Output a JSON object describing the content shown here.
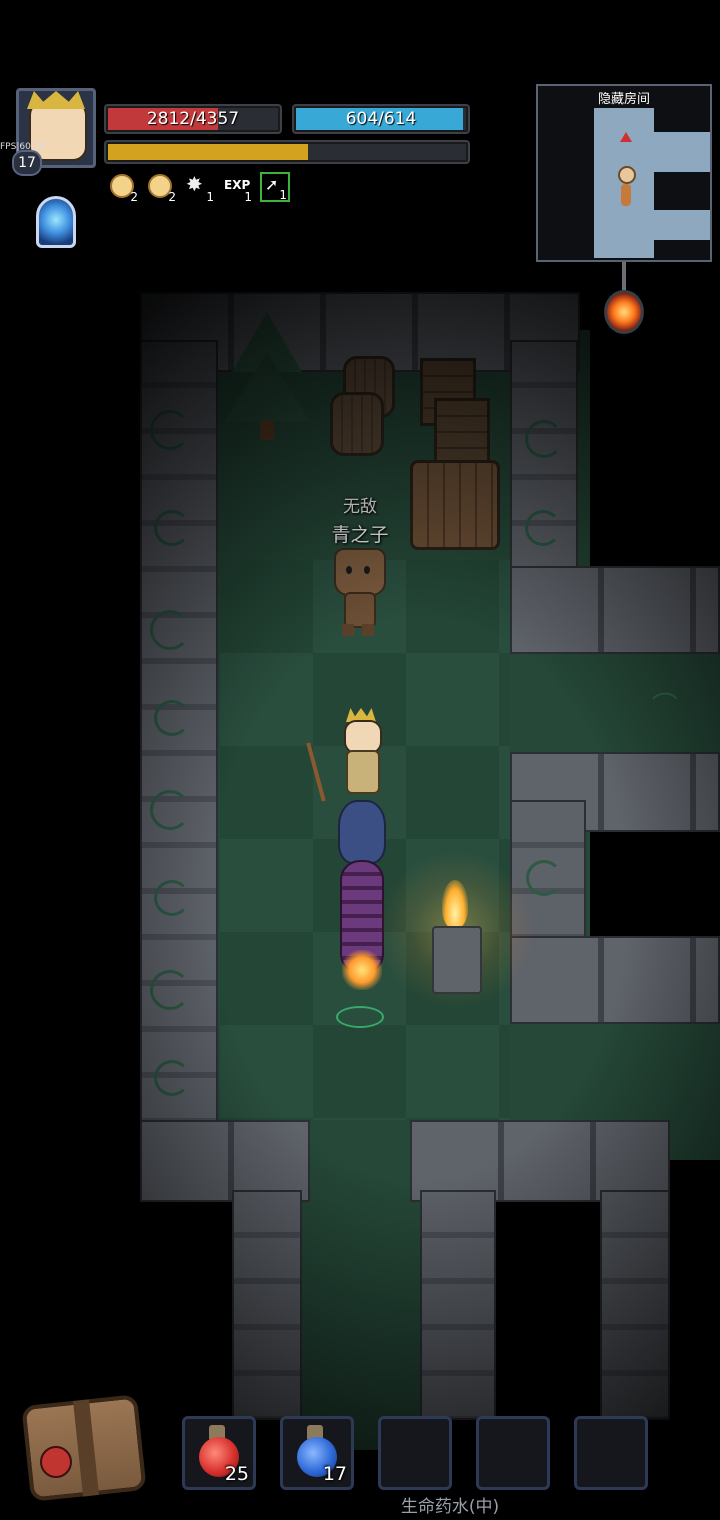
{
  "hud": {
    "fps_label": "FPS|60.38",
    "level": "17",
    "hp": {
      "text": "2812/4357",
      "fraction": 0.645,
      "color": "#c1393b"
    },
    "mp": {
      "text": "604/614",
      "fraction": 0.984,
      "color": "#38a9d6"
    },
    "xp": {
      "fraction": 0.56,
      "color": "#d3a21e"
    },
    "buffs": [
      {
        "icon": "star-medal-icon",
        "count": "2"
      },
      {
        "icon": "star-medal-icon",
        "count": "2"
      },
      {
        "icon": "burst-icon",
        "count": "1"
      },
      {
        "icon": "exp-up-icon",
        "label": "EXP",
        "count": "1"
      },
      {
        "icon": "skill-up-icon",
        "count": "1"
      }
    ]
  },
  "minimap": {
    "title": "隐藏房间"
  },
  "scene": {
    "npc_title": "无敌",
    "npc_name": "青之子"
  },
  "quickbar": {
    "slots": [
      {
        "icon": "red-potion-icon",
        "count": "25",
        "color": "#d8322f"
      },
      {
        "icon": "blue-potion-icon",
        "count": "17",
        "color": "#2f6ad8"
      },
      {
        "icon": "",
        "count": ""
      },
      {
        "icon": "",
        "count": ""
      },
      {
        "icon": "",
        "count": ""
      }
    ],
    "selected_item_name": "生命药水(中)"
  }
}
